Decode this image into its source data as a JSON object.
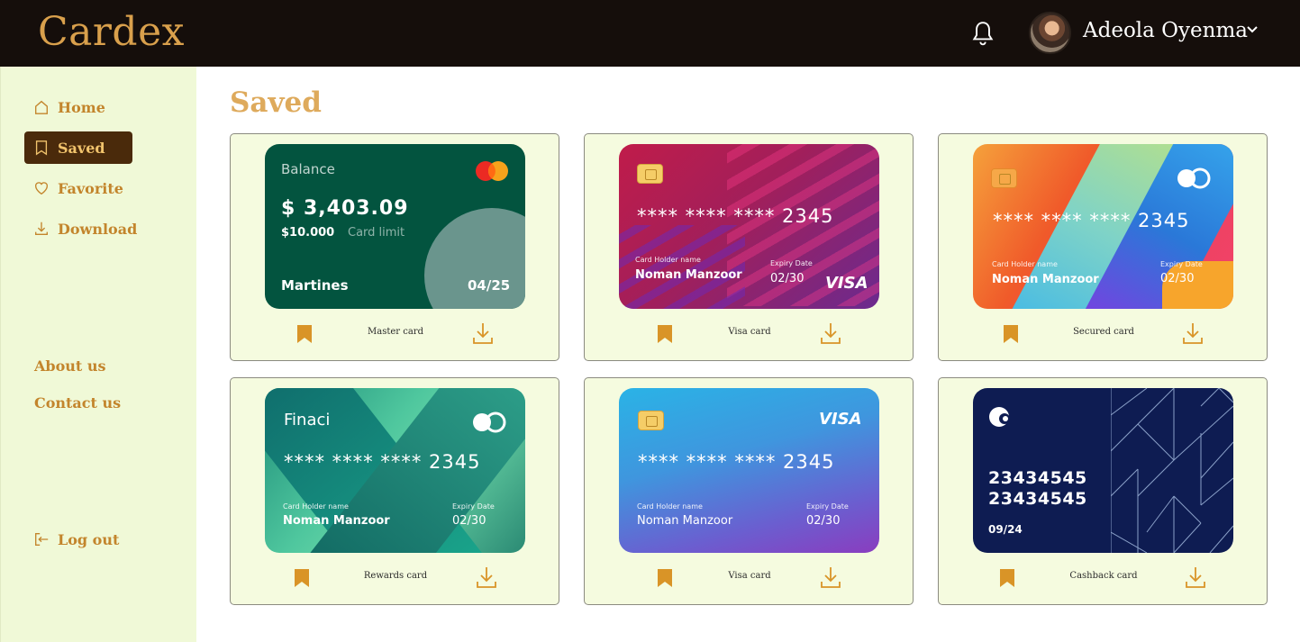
{
  "app": {
    "title": "Cardex"
  },
  "user": {
    "name": "Adeola Oyenma"
  },
  "sidebar": {
    "items": [
      {
        "label": "Home"
      },
      {
        "label": "Saved"
      },
      {
        "label": "Favorite"
      },
      {
        "label": "Download"
      }
    ],
    "links": [
      {
        "label": "About us"
      },
      {
        "label": "Contact us"
      }
    ],
    "logout": "Log out"
  },
  "main": {
    "title": "Saved",
    "cards": [
      {
        "label": "Master card",
        "balance_label": "Balance",
        "balance": "$ 3,403.09",
        "limit": "$10.000",
        "limit_label": "Card limit",
        "holder": "Martines",
        "expiry": "04/25"
      },
      {
        "label": "Visa card",
        "number": "**** **** **** 2345",
        "holder_label": "Card Holder name",
        "holder": "Noman Manzoor",
        "expiry_label": "Expiry Date",
        "expiry": "02/30",
        "brand": "VISA"
      },
      {
        "label": "Secured card",
        "number": "**** **** **** 2345",
        "holder_label": "Card Holder name",
        "holder": "Noman Manzoor",
        "expiry_label": "Expiry Date",
        "expiry": "02/30"
      },
      {
        "label": "Rewards card",
        "bank": "Finaci",
        "number": "**** **** **** 2345",
        "holder_label": "Card Holder name",
        "holder": "Noman Manzoor",
        "expiry_label": "Expiry Date",
        "expiry": "02/30"
      },
      {
        "label": "Visa card",
        "brand": "VISA",
        "number": "**** **** **** 2345",
        "holder_label": "Card Holder name",
        "holder": "Noman Manzoor",
        "expiry_label": "Expiry Date",
        "expiry": "02/30"
      },
      {
        "label": "Cashback card",
        "number_line1": "23434545",
        "number_line2": "23434545",
        "expiry": "09/24"
      }
    ]
  },
  "colors": {
    "header": "#150e0b",
    "accent": "#c3852c",
    "sidebar_bg": "#f0f9d7",
    "active_nav": "#4a2a0b",
    "tile_bg": "#f5fbdf"
  }
}
